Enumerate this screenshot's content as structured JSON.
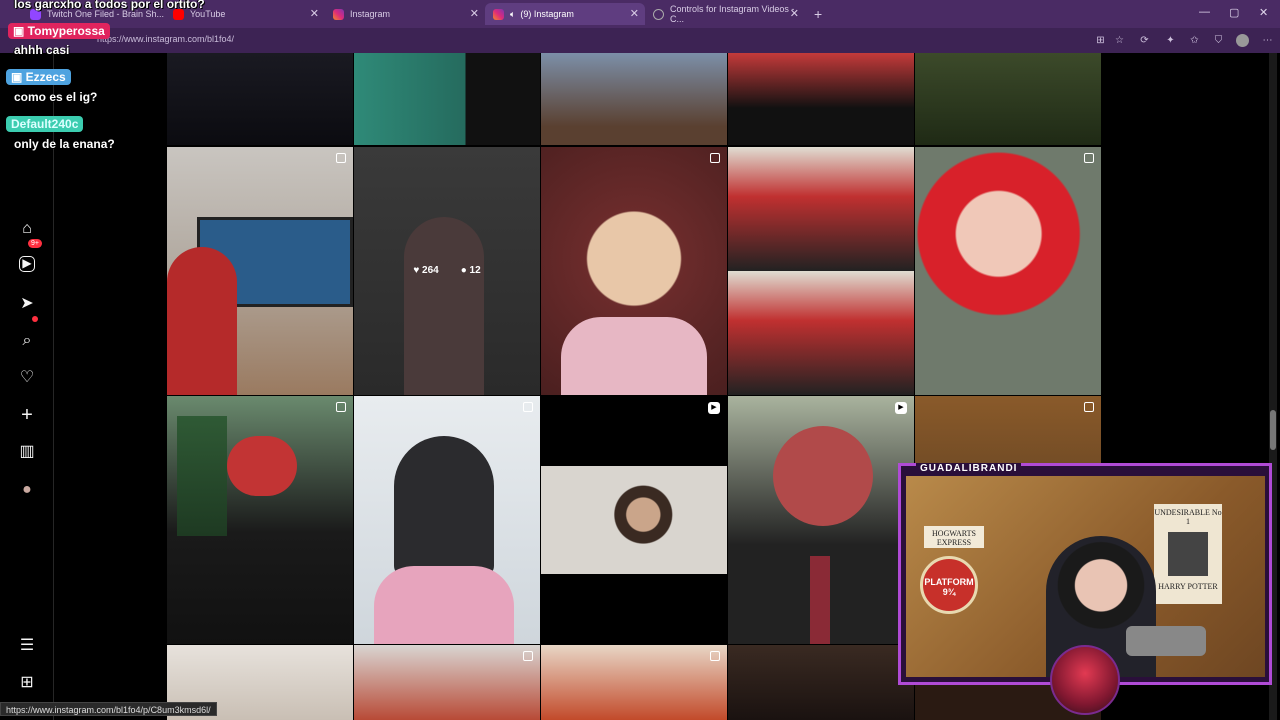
{
  "browser": {
    "tabs": [
      {
        "label": "Twitch One Filed - Brain Sh...",
        "active": false
      },
      {
        "label": "YouTube",
        "active": false
      },
      {
        "label": "Instagram",
        "active": false
      },
      {
        "label": "(9) Instagram",
        "active": true
      },
      {
        "label": "Controls for Instagram Videos - C...",
        "active": false
      }
    ],
    "new_tab": "+",
    "window_controls": [
      "—",
      "▢",
      "✕"
    ],
    "url": "https://www.instagram.com/bl1fo4/"
  },
  "chat": [
    {
      "type": "message",
      "text": "los garcxho a todos por el ortito?"
    },
    {
      "type": "user",
      "name": "Tomyperossa",
      "color": "#e0245e"
    },
    {
      "type": "message",
      "text": "ahhh casi"
    },
    {
      "type": "user",
      "name": "Ezzecs",
      "color": "#4ea3e0"
    },
    {
      "type": "message",
      "text": "como es el ig?"
    },
    {
      "type": "user",
      "name": "Default240c",
      "color": "#3ccdb0"
    },
    {
      "type": "message",
      "text": "only de la enana?"
    }
  ],
  "sidebar": {
    "items": [
      {
        "name": "home-icon",
        "glyph": "⌂"
      },
      {
        "name": "reels-icon",
        "glyph": "▶"
      },
      {
        "name": "messages-icon",
        "glyph": "➤"
      },
      {
        "name": "search-icon",
        "glyph": "⌕"
      },
      {
        "name": "notifications-icon",
        "glyph": "♡"
      },
      {
        "name": "create-icon",
        "glyph": "+"
      },
      {
        "name": "dashboard-icon",
        "glyph": "▥"
      },
      {
        "name": "profile-icon",
        "glyph": "●"
      }
    ],
    "messages_badge": "9+",
    "more_icon": "☰",
    "apps_icon": "⊞"
  },
  "grid": {
    "hovered_post": {
      "likes": "264",
      "comments": "12"
    }
  },
  "status_bar": {
    "url": "https://www.instagram.com/bl1fo4/p/C8um3kmsd6l/"
  },
  "webcam": {
    "title": "GUADALIBRANDI",
    "signs": [
      "HOGWARTS EXPRESS",
      "PLATFORM 9¾",
      "UNDESIRABLE No 1",
      "HARRY POTTER"
    ]
  }
}
